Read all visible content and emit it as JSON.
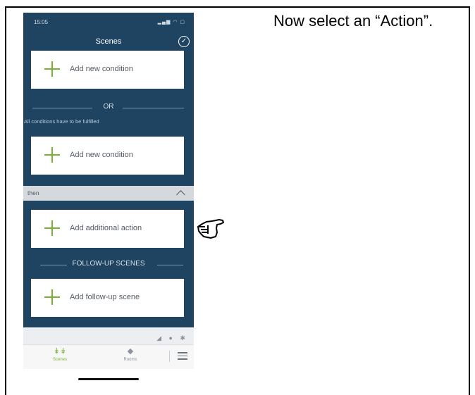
{
  "status_bar": {
    "time": "15:05",
    "icons": "▂▄▆ ◠ ▢"
  },
  "header": {
    "title": "Scenes",
    "confirm_icon": "✓"
  },
  "conditions": {
    "card1_label": "Add new condition",
    "or_label": "OR",
    "note": "All conditions have to be fulfilled",
    "card2_label": "Add new condition"
  },
  "then_section": {
    "label": "then",
    "collapse_icon": "chevron-up-icon"
  },
  "actions": {
    "card_label": "Add additional action",
    "followup_header": "FOLLOW-UP SCENES",
    "followup_card_label": "Add follow-up scene"
  },
  "tab_bar": {
    "tabs": [
      {
        "label": "Scenes",
        "icon": "↡↡",
        "color": "#7bb133"
      },
      {
        "label": "Rooms",
        "icon": "◆",
        "color": "#8a939b"
      }
    ]
  },
  "instruction": {
    "text": "Now select an “Action”."
  },
  "colors": {
    "primary_dark": "#1e4461",
    "accent_green": "#7bb133"
  }
}
